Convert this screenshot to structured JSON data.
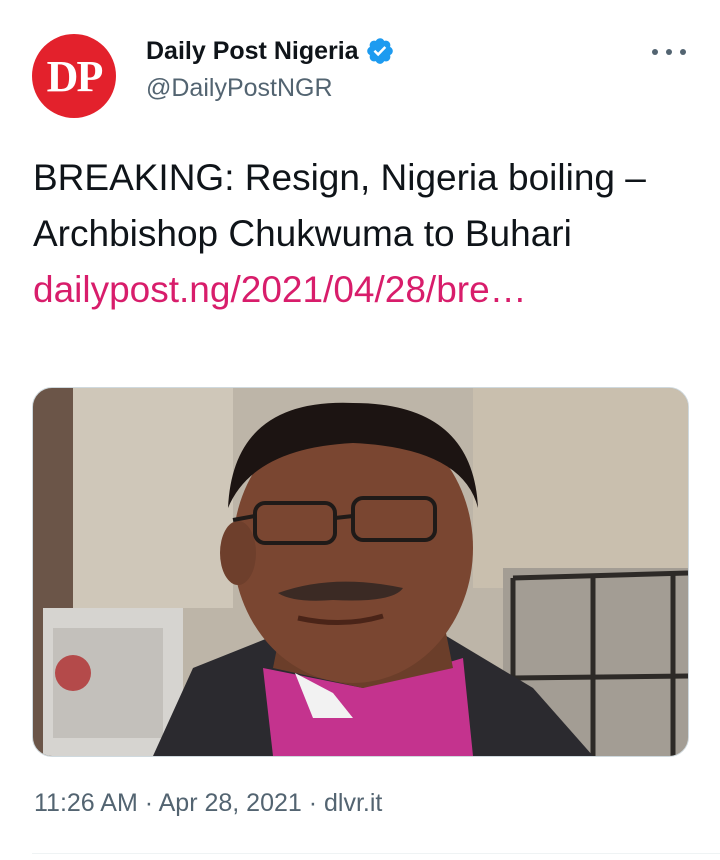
{
  "account": {
    "avatar_text": "DP",
    "display_name": "Daily Post Nigeria",
    "handle": "@DailyPostNGR",
    "verified_icon": "verified-badge-icon"
  },
  "tweet": {
    "text": "BREAKING: Resign, Nigeria boiling – Archbishop Chukwuma to Buhari",
    "link": "dailypost.ng/2021/04/28/bre…",
    "time": "11:26 AM",
    "separator1": " · ",
    "date": "Apr 28, 2021",
    "separator2": " · ",
    "source": "dlvr.it"
  },
  "colors": {
    "avatar_bg": "#e3212c",
    "link": "#d81d6b",
    "verified": "#1d9bf0",
    "secondary_text": "#536471",
    "robe": "#c4338e"
  },
  "icons": {
    "more": "more-horizontal-icon"
  }
}
